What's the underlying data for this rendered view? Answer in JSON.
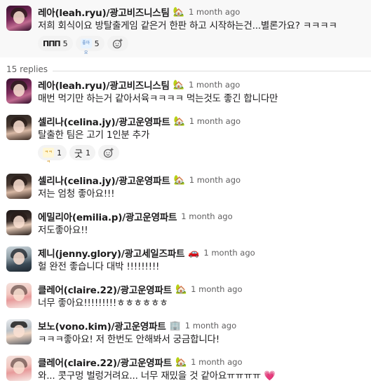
{
  "parent": {
    "author": "레아(leah.ryu)/광고비즈니스팀",
    "status_emoji": "🏡",
    "time": "1 month ago",
    "text": "저희 회식이요 방탈출게임 같은거 한판 하고 시작하는건...별론가요? ㅋㅋㅋㅋ",
    "reactions": [
      {
        "emoji": "ΠΠΠ",
        "count": "5"
      },
      {
        "emoji": "좋아요",
        "count": "5"
      }
    ]
  },
  "reply_count": "15 replies",
  "replies": [
    {
      "author": "레아(leah.ryu)/광고비즈니스팀",
      "status_emoji": "🏡",
      "time": "1 month ago",
      "text": "매번 먹기만 하는거 같아서육ㅋㅋㅋㅋ 먹는것도 좋긴 합니다만"
    },
    {
      "author": "셀리나(celina.jy)/광고운영파트",
      "status_emoji": "🏡",
      "time": "1 month ago",
      "text": "탈출한 팀은 고기 1인분 추가",
      "reactions": [
        {
          "emoji": "ㅋㅋㅋ",
          "count": "1"
        },
        {
          "emoji": "굿",
          "count": "1"
        }
      ]
    },
    {
      "author": "셀리나(celina.jy)/광고운영파트",
      "status_emoji": "🏡",
      "time": "1 month ago",
      "text": "저는 엄청 좋아요!!!"
    },
    {
      "author": "에밀리아(emilia.p)/광고운영파트",
      "status_emoji": "",
      "time": "1 month ago",
      "text": "저도좋아요!!"
    },
    {
      "author": "제니(jenny.glory)/광고세일즈파트",
      "status_emoji": "🚗",
      "time": "1 month ago",
      "text": "헐 완전 좋습니다 대박 !!!!!!!!!"
    },
    {
      "author": "클레어(claire.22)/광고운영파트",
      "status_emoji": "🏡",
      "time": "1 month ago",
      "text": "너무 좋아요!!!!!!!!!ㅎㅎㅎㅎㅎㅎ"
    },
    {
      "author": "보노(vono.kim)/광고운영파트",
      "status_emoji": "🏢",
      "time": "1 month ago",
      "text": "ㅋㅋㅋ좋아요! 저 한번도 안해봐서 궁금합니다!"
    },
    {
      "author": "클레어(claire.22)/광고운영파트",
      "status_emoji": "🏡",
      "time": "1 month ago",
      "text": "와... 콧구멍 벌렁거려요... 너무 재밌을 것 같아요ㅠㅠㅠㅠ 💗"
    }
  ]
}
